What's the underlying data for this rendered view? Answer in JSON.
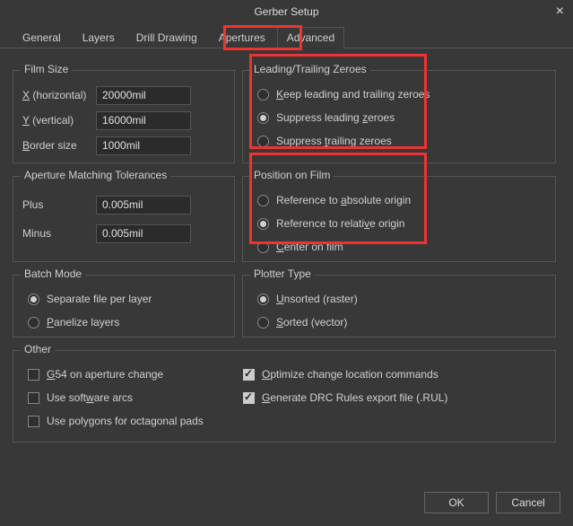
{
  "title": "Gerber Setup",
  "tabs": {
    "general": "General",
    "layers": "Layers",
    "drill": "Drill Drawing",
    "apertures": "Apertures",
    "advanced": "Advanced"
  },
  "film_size": {
    "title": "Film Size",
    "x_label_pre": "X",
    "x_label_post": " (horizontal)",
    "x_value": "20000mil",
    "y_label_pre": "Y",
    "y_label_post": " (vertical)",
    "y_value": "16000mil",
    "border_label_pre": "B",
    "border_label_post": "order size",
    "border_value": "1000mil"
  },
  "aperture_tol": {
    "title": "Aperture Matching Tolerances",
    "plus_label": "Plus",
    "plus_value": "0.005mil",
    "minus_label": "Minus",
    "minus_value": "0.005mil"
  },
  "batch_mode": {
    "title": "Batch Mode",
    "separate": "Separate file per layer",
    "panelize_pre": "P",
    "panelize_post": "anelize layers"
  },
  "zeroes": {
    "title": "Leading/Trailing Zeroes",
    "keep_pre": "K",
    "keep_post": "eep leading and trailing zeroes",
    "suppress_leading_a": "Suppress leading ",
    "suppress_leading_u": "z",
    "suppress_leading_b": "eroes",
    "suppress_trailing_a": "Suppress ",
    "suppress_trailing_u": "t",
    "suppress_trailing_b": "railing zeroes"
  },
  "position": {
    "title": "Position on Film",
    "abs_a": "Reference to ",
    "abs_u": "a",
    "abs_b": "bsolute origin",
    "rel_a": "Reference to relati",
    "rel_u": "v",
    "rel_b": "e origin",
    "center_pre": "C",
    "center_post": "enter on film"
  },
  "plotter": {
    "title": "Plotter Type",
    "unsorted_pre": "U",
    "unsorted_post": "nsorted (raster)",
    "sorted_pre": "S",
    "sorted_post": "orted (vector)"
  },
  "other": {
    "title": "Other",
    "g54_pre": "G",
    "g54_post": "54 on aperture change",
    "soft_a": "Use soft",
    "soft_u": "w",
    "soft_b": "are arcs",
    "poly": "Use polygons for octagonal pads",
    "opt_pre": "O",
    "opt_post": "ptimize change location commands",
    "drc_pre": "G",
    "drc_post": "enerate DRC Rules export file (.RUL)"
  },
  "buttons": {
    "ok": "OK",
    "cancel": "Cancel"
  }
}
